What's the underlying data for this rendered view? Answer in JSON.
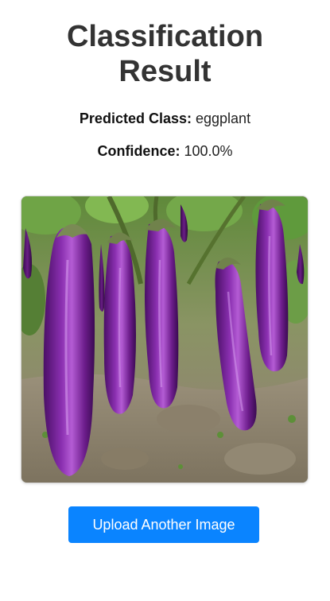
{
  "header": {
    "title_line1": "Classification",
    "title_line2": "Result"
  },
  "result": {
    "predicted_label": "Predicted Class:",
    "predicted_value": "eggplant",
    "confidence_label": "Confidence:",
    "confidence_value": "100.0%"
  },
  "image": {
    "alt": "Uploaded image: eggplants growing in a field"
  },
  "actions": {
    "upload_label": "Upload Another Image"
  },
  "colors": {
    "primary_button": "#0a84ff",
    "title_text": "#333333"
  }
}
